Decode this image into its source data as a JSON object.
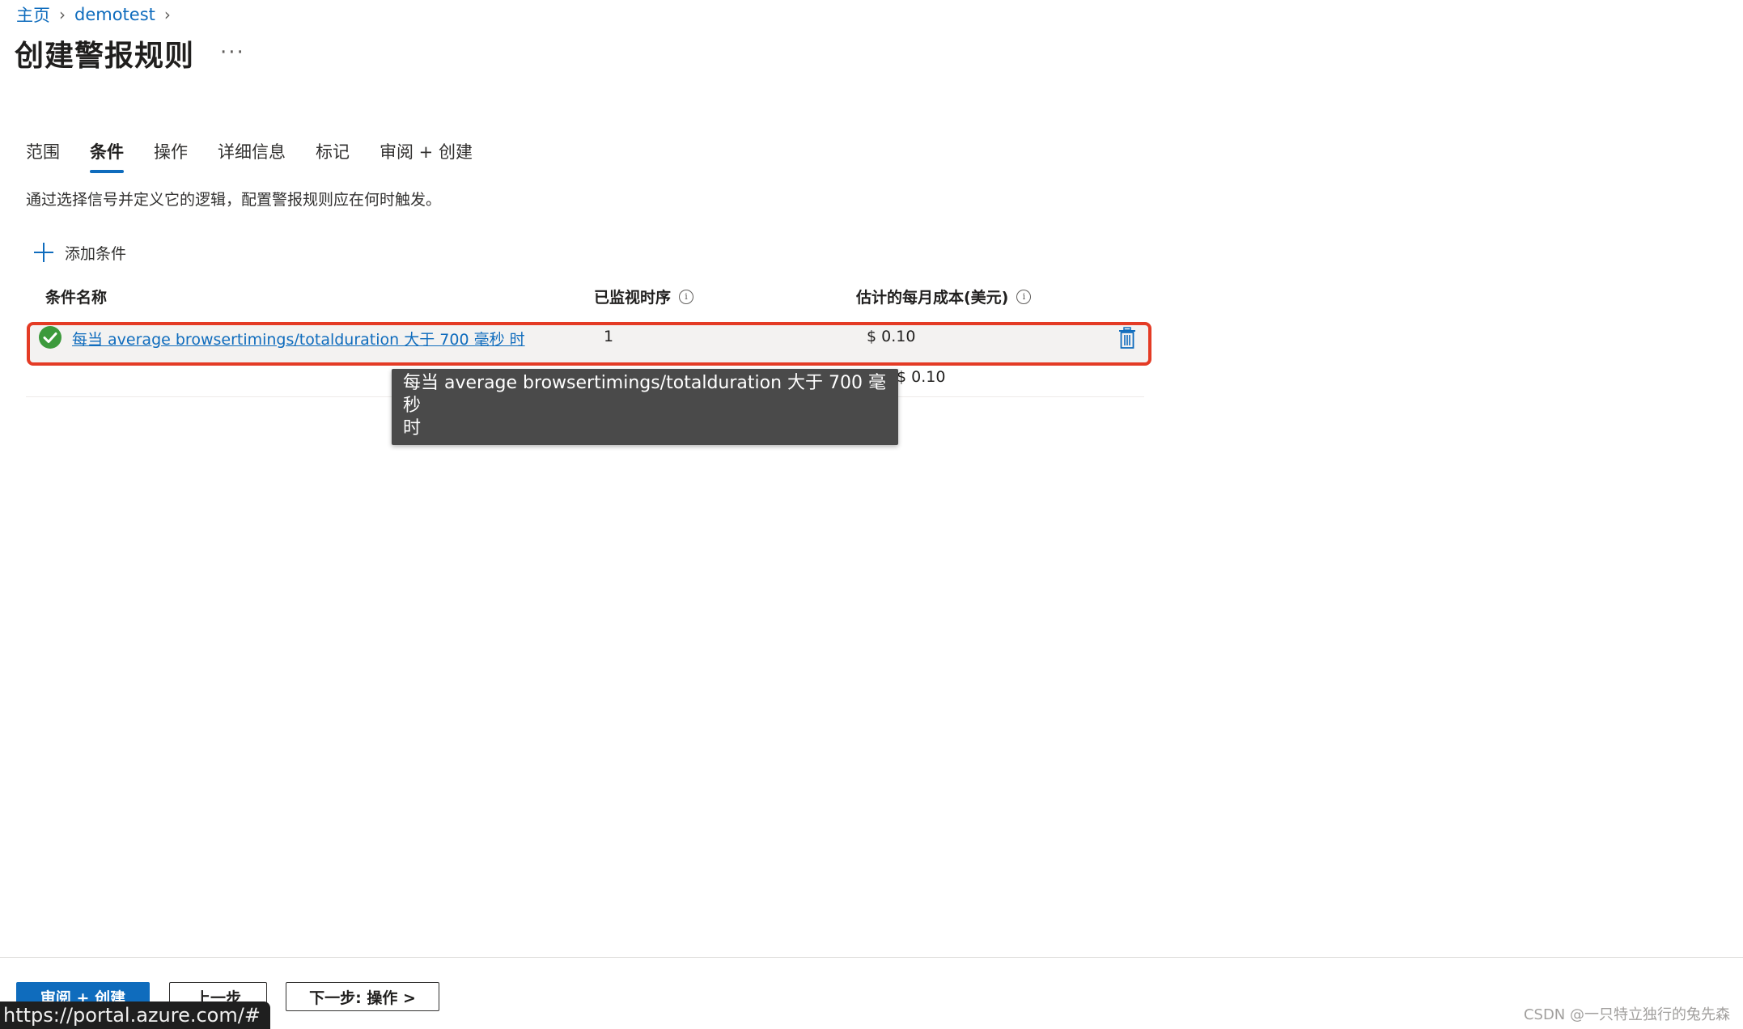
{
  "breadcrumb": {
    "home": "主页",
    "resource": "demotest"
  },
  "page": {
    "title": "创建警报规则",
    "more": "···"
  },
  "tabs": [
    {
      "label": "范围"
    },
    {
      "label": "条件",
      "active": true
    },
    {
      "label": "操作"
    },
    {
      "label": "详细信息"
    },
    {
      "label": "标记"
    },
    {
      "label": "审阅 + 创建"
    }
  ],
  "description": "通过选择信号并定义它的逻辑，配置警报规则应在何时触发。",
  "add_condition_label": "添加条件",
  "table": {
    "headers": {
      "name": "条件名称",
      "series": "已监视时序",
      "cost": "估计的每月成本(美元)"
    },
    "rows": [
      {
        "name": "每当 average browsertimings/totalduration 大于 700 毫秒 时",
        "series": "1",
        "cost": "$ 0.10"
      }
    ],
    "total_cost": "$ 0.10"
  },
  "tooltip": {
    "line1": "每当 average browsertimings/totalduration 大于 700 毫秒",
    "line2": "时"
  },
  "footer": {
    "review_create": "审阅 + 创建",
    "previous": "上一步",
    "next": "下一步: 操作 >"
  },
  "status_url": "https://portal.azure.com/#",
  "watermark": "CSDN @一只特立独行的兔先森",
  "colors": {
    "accent": "#0f6cbd",
    "highlight": "#e43b25",
    "success": "#3c9a3c"
  }
}
